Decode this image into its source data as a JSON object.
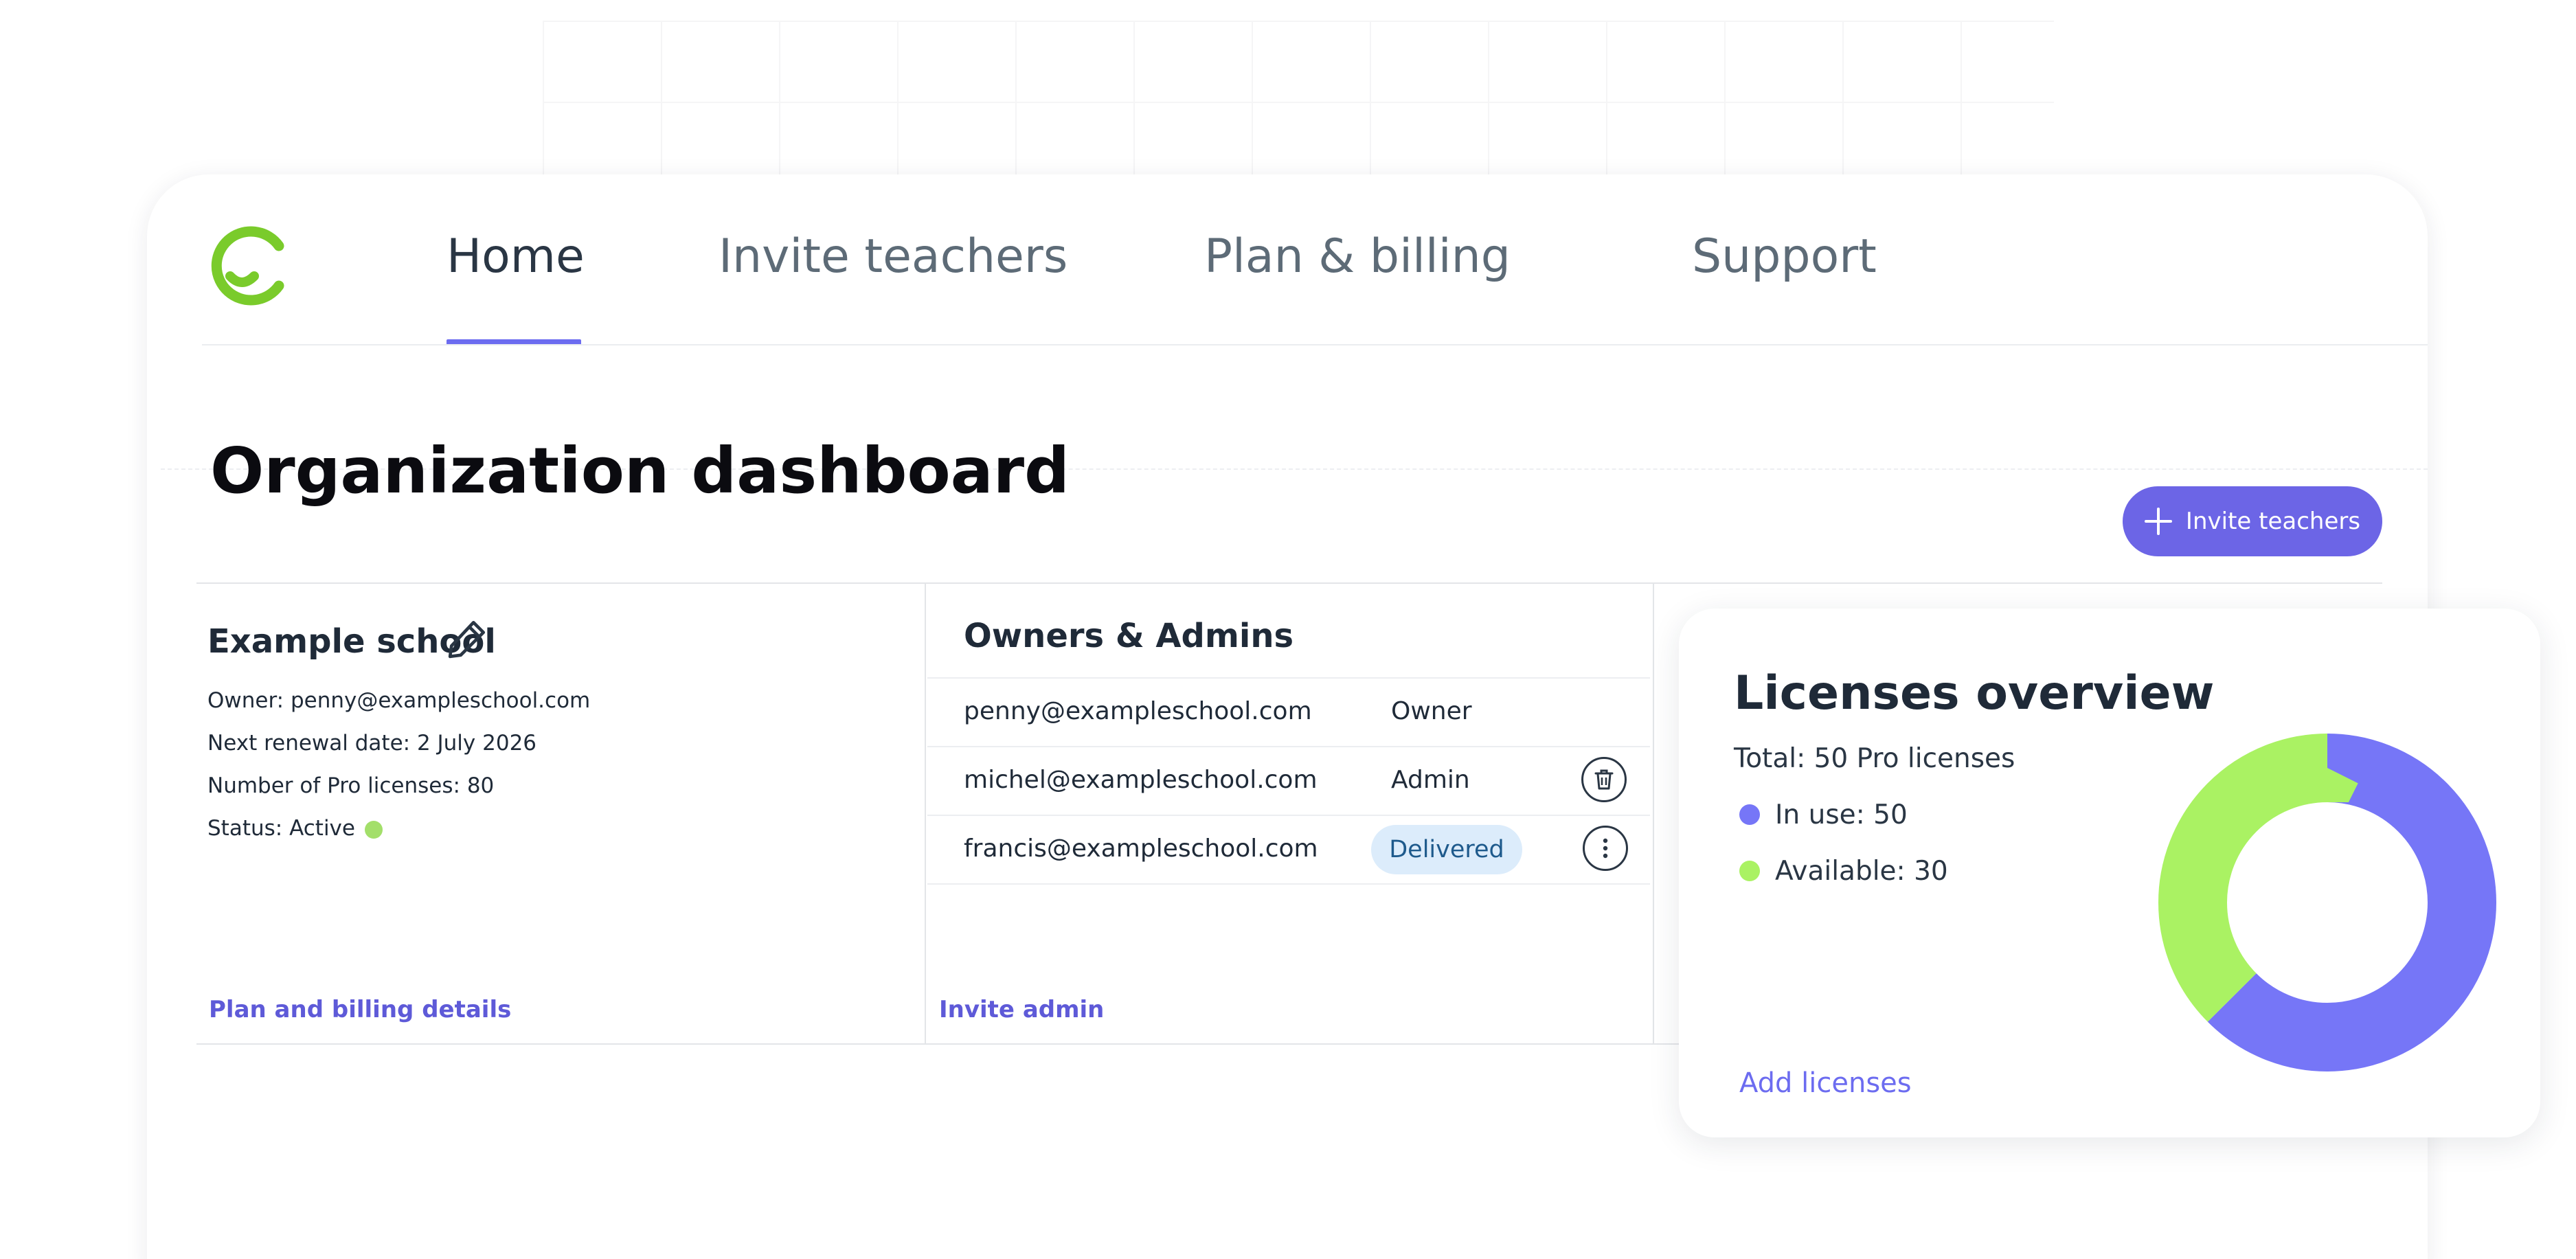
{
  "nav": {
    "tabs": [
      {
        "label": "Home",
        "active": true
      },
      {
        "label": "Invite teachers",
        "active": false
      },
      {
        "label": "Plan & billing",
        "active": false
      },
      {
        "label": "Support",
        "active": false
      }
    ]
  },
  "page": {
    "title": "Organization dashboard",
    "invite_button": "Invite teachers"
  },
  "school": {
    "name": "Example school",
    "owner": "Owner: penny@exampleschool.com",
    "renewal": "Next renewal date: 2 July 2026",
    "licenses": "Number of Pro licenses: 80",
    "status": "Status: Active",
    "link": "Plan and billing details"
  },
  "owners": {
    "title": "Owners & Admins",
    "rows": [
      {
        "email": "penny@exampleschool.com",
        "role": "Owner"
      },
      {
        "email": "michel@exampleschool.com",
        "role": "Admin"
      },
      {
        "email": "francis@exampleschool.com",
        "role": "Delivered"
      }
    ],
    "link": "Invite admin"
  },
  "licenses": {
    "title": "Licenses overview",
    "total": "Total: 50 Pro licenses",
    "legend": {
      "in_use": "In use: 50",
      "available": "Available: 30"
    },
    "link": "Add licenses"
  },
  "chart_data": {
    "type": "pie",
    "donut": true,
    "categories": [
      "In use",
      "Available"
    ],
    "values": [
      50,
      30
    ],
    "colors": [
      "#7676f7",
      "#aaf263"
    ],
    "title": "Licenses overview"
  },
  "colors": {
    "accent": "#6c65e6",
    "in_use": "#7676f7",
    "available": "#aaf263",
    "status_active": "#a3df6a",
    "logo": "#7acb2b"
  },
  "icons": {
    "logo": "smile-c-logo-icon",
    "edit": "pencil-icon",
    "delete": "trash-icon",
    "more": "more-vertical-icon",
    "add": "plus-icon"
  }
}
